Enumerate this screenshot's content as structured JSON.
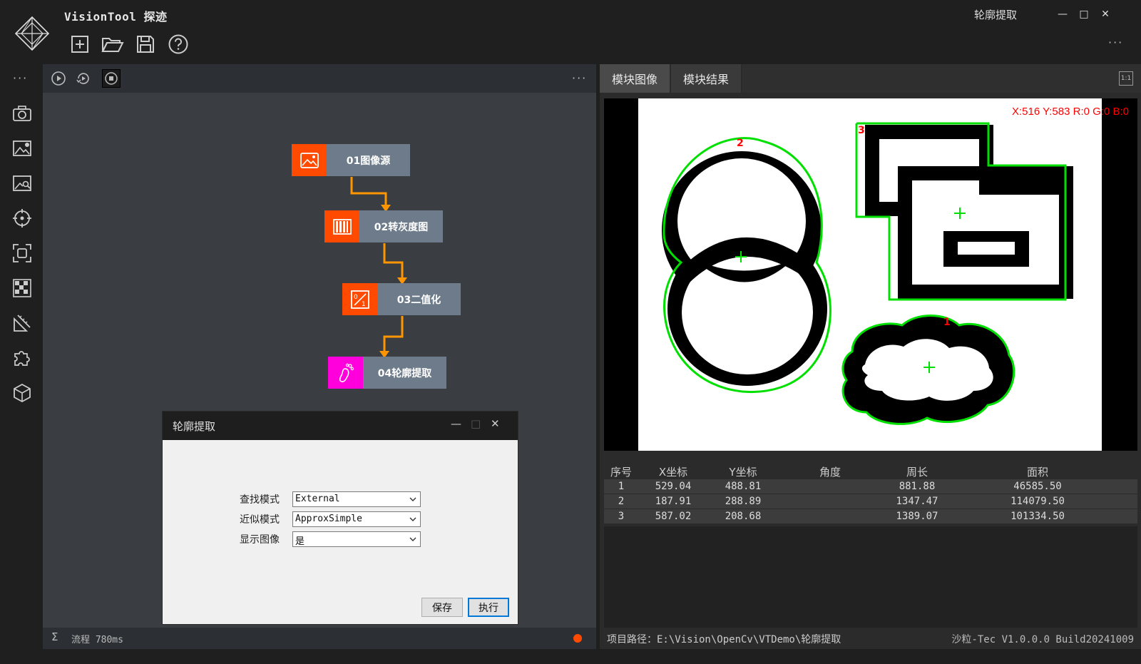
{
  "app": {
    "title": "VisionTool 探迹",
    "window_title": "轮廓提取"
  },
  "window_controls": {
    "minimize": "—",
    "maximize": "□",
    "close": "✕"
  },
  "toolbar": {
    "new_icon": "new-file-icon",
    "open_icon": "folder-open-icon",
    "save_icon": "save-icon",
    "help_icon": "help-icon"
  },
  "sidebar": {
    "items": [
      "camera-icon",
      "image-settings-icon",
      "image-search-icon",
      "target-icon",
      "focus-frame-icon",
      "grid-pattern-icon",
      "measure-icon",
      "puzzle-icon",
      "cube-icon"
    ]
  },
  "flow": {
    "nodes": [
      {
        "label": "01图像源",
        "icon": "picture-icon",
        "color": "#ff4a00"
      },
      {
        "label": "02转灰度图",
        "icon": "grayscale-bars-icon",
        "color": "#ff4a00"
      },
      {
        "label": "03二值化",
        "icon": "binary-icon",
        "color": "#ff4a00"
      },
      {
        "label": "04轮廓提取",
        "icon": "footprint-icon",
        "color": "#ff00dd"
      }
    ],
    "arrow_color": "#ff9500",
    "status": "流程 780ms",
    "status_dot_color": "#ff4a00"
  },
  "dialog": {
    "title": "轮廓提取",
    "fields": [
      {
        "label": "查找模式",
        "value": "External"
      },
      {
        "label": "近似模式",
        "value": "ApproxSimple"
      },
      {
        "label": "显示图像",
        "value": "是"
      }
    ],
    "save_label": "保存",
    "run_label": "执行"
  },
  "right": {
    "tabs": [
      "模块图像",
      "模块结果"
    ],
    "ratio_label": "1:1",
    "pixel_readout": "X:516 Y:583  R:0 G:0 B:0",
    "contour_labels": [
      "1",
      "2",
      "3"
    ],
    "table": {
      "headers": [
        "序号",
        "X坐标",
        "Y坐标",
        "角度",
        "周长",
        "面积"
      ],
      "rows": [
        [
          "1",
          "529.04",
          "488.81",
          "",
          "881.88",
          "46585.50"
        ],
        [
          "2",
          "187.91",
          "288.89",
          "",
          "1347.47",
          "114079.50"
        ],
        [
          "3",
          "587.02",
          "208.68",
          "",
          "1389.07",
          "101334.50"
        ]
      ]
    },
    "project_path": "项目路径：E:\\Vision\\OpenCv\\VTDemo\\轮廓提取",
    "version": "沙粒-Tec V1.0.0.0 Build20241009"
  }
}
